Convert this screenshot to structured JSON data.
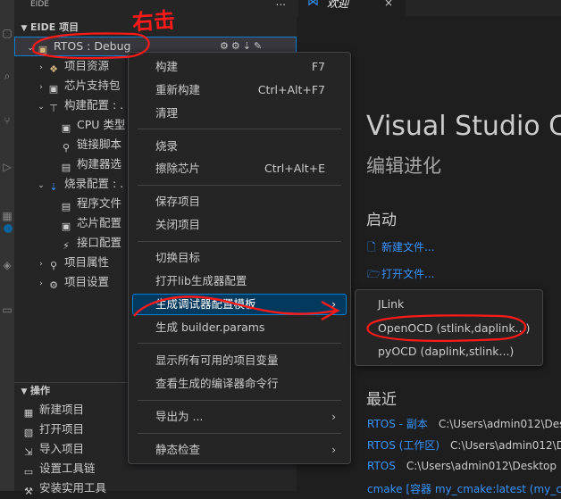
{
  "sidebar": {
    "title": "EIDE",
    "more": "...",
    "section_title": "EIDE 项目",
    "project": {
      "label": "RTOS : Debug"
    },
    "tree": [
      {
        "label": "项目资源"
      },
      {
        "label": "芯片支持包"
      },
      {
        "label": "构建配置 : ."
      },
      {
        "label": "CPU 类型"
      },
      {
        "label": "链接脚本"
      },
      {
        "label": "构建器选"
      },
      {
        "label": "烧录配置 : ."
      },
      {
        "label": "程序文件"
      },
      {
        "label": "芯片配置"
      },
      {
        "label": "接口配置"
      },
      {
        "label": "项目属性"
      },
      {
        "label": "项目设置"
      }
    ],
    "ops_title": "操作",
    "ops": [
      {
        "label": "新建项目"
      },
      {
        "label": "打开项目"
      },
      {
        "label": "导入项目"
      },
      {
        "label": "设置工具链"
      },
      {
        "label": "安装实用工具"
      }
    ]
  },
  "tab": {
    "label": "欢迎",
    "close": "×"
  },
  "welcome": {
    "title": "Visual Studio C",
    "subtitle": "编辑进化",
    "start_heading": "启动",
    "new_file": "新建文件...",
    "open_file": "打开文件...",
    "recent_heading": "最近",
    "recent": [
      {
        "name": "RTOS - 副本",
        "path": "C:\\Users\\admin012\\Desk"
      },
      {
        "name": "RTOS (工作区)",
        "path": "C:\\Users\\admin012\\Des"
      },
      {
        "name": "RTOS",
        "path": "C:\\Users\\admin012\\Desktop"
      },
      {
        "name": "cmake [容器 my_cmake:latest (my_cm",
        "path": ""
      }
    ]
  },
  "context_menu": [
    {
      "label": "构建",
      "shortcut": "F7"
    },
    {
      "label": "重新构建",
      "shortcut": "Ctrl+Alt+F7"
    },
    {
      "label": "清理",
      "shortcut": ""
    },
    {
      "label": "烧录",
      "shortcut": ""
    },
    {
      "label": "擦除芯片",
      "shortcut": "Ctrl+Alt+E"
    },
    {
      "label": "保存项目",
      "shortcut": ""
    },
    {
      "label": "关闭项目",
      "shortcut": ""
    },
    {
      "label": "切换目标",
      "shortcut": ""
    },
    {
      "label": "打开lib生成器配置",
      "shortcut": ""
    },
    {
      "label": "生成调试器配置模板",
      "shortcut": ""
    },
    {
      "label": "生成 builder.params",
      "shortcut": ""
    },
    {
      "label": "显示所有可用的项目变量",
      "shortcut": ""
    },
    {
      "label": "查看生成的编译器命令行",
      "shortcut": ""
    },
    {
      "label": "导出为 ...",
      "shortcut": ""
    },
    {
      "label": "静态检查",
      "shortcut": ""
    }
  ],
  "submenu": [
    {
      "label": "JLink"
    },
    {
      "label": "OpenOCD (stlink,daplink...)"
    },
    {
      "label": "pyOCD (daplink,stlink...)"
    }
  ],
  "annotation": {
    "text": "右击"
  },
  "colors": {
    "accent": "#007fd4",
    "link": "#3794ff",
    "annotation_red": "#ff1a1a"
  }
}
